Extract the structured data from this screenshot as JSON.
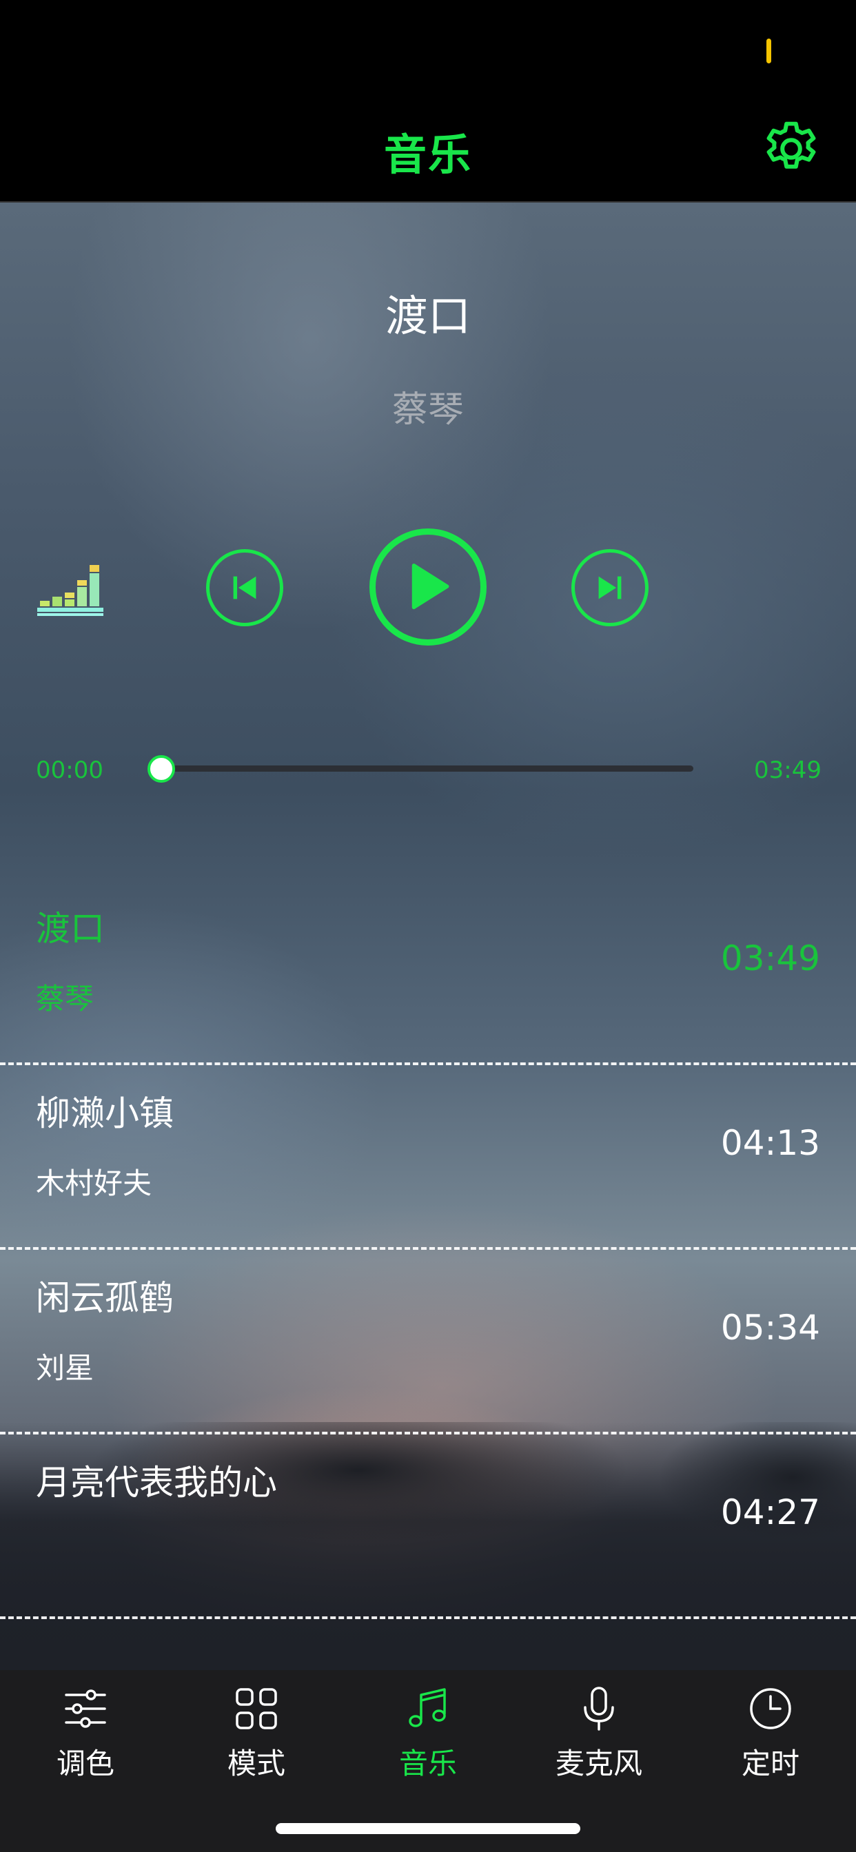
{
  "app": {
    "title": "音乐"
  },
  "now_playing": {
    "title": "渡口",
    "artist": "蔡琴",
    "current_time": "00:00",
    "total_time": "03:49",
    "progress": 0.0
  },
  "controls": {
    "equalizer_icon": "equalizer-icon",
    "previous_icon": "skip-previous-icon",
    "play_icon": "play-icon",
    "next_icon": "skip-next-icon"
  },
  "playlist": [
    {
      "title": "渡口",
      "artist": "蔡琴",
      "duration": "03:49",
      "active": true
    },
    {
      "title": "柳濑小镇",
      "artist": "木村好夫",
      "duration": "04:13",
      "active": false
    },
    {
      "title": "闲云孤鹤",
      "artist": "刘星",
      "duration": "05:34",
      "active": false
    },
    {
      "title": "月亮代表我的心",
      "artist": "",
      "duration": "04:27",
      "active": false
    }
  ],
  "tabs": [
    {
      "label": "调色",
      "icon": "sliders-icon",
      "active": false
    },
    {
      "label": "模式",
      "icon": "grid-icon",
      "active": false
    },
    {
      "label": "音乐",
      "icon": "music-note-icon",
      "active": true
    },
    {
      "label": "麦克风",
      "icon": "microphone-icon",
      "active": false
    },
    {
      "label": "定时",
      "icon": "clock-icon",
      "active": false
    }
  ],
  "colors": {
    "accent": "#19e64a",
    "active_text": "#19c43c",
    "tab_bar_bg": "#1c1c1e",
    "battery": "#f5c400"
  }
}
